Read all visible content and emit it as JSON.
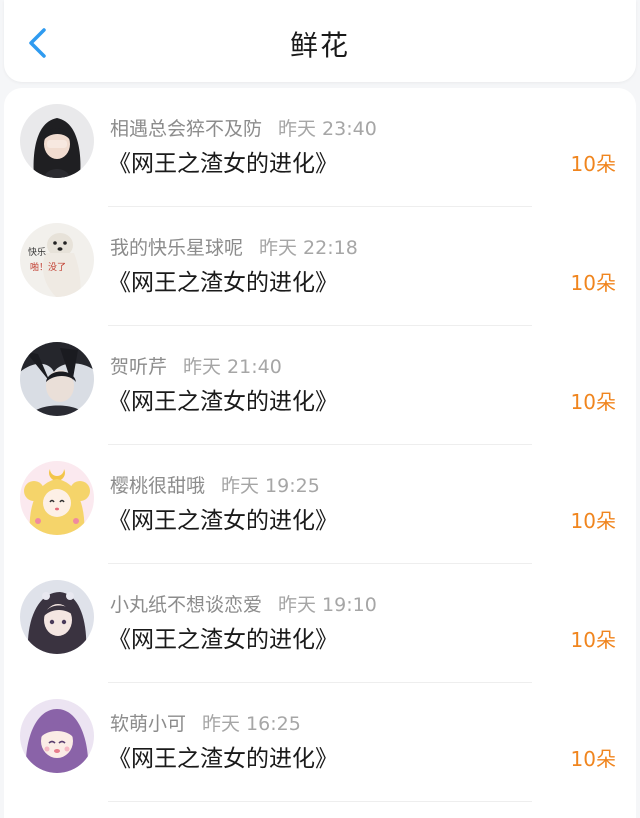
{
  "header": {
    "title": "鲜花"
  },
  "colors": {
    "accent_blue": "#2f9bf0",
    "amount_orange": "#f0851e"
  },
  "rows": [
    {
      "user": "相遇总会猝不及防",
      "time": "昨天 23:40",
      "book": "《网王之渣女的进化》",
      "amount": "10朵",
      "avatar_icon": "avatar-girl-dark-hair-icon"
    },
    {
      "user": "我的快乐星球呢",
      "time": "昨天 22:18",
      "book": "《网王之渣女的进化》",
      "amount": "10朵",
      "avatar_icon": "avatar-dog-meme-icon"
    },
    {
      "user": "贺听芹",
      "time": "昨天 21:40",
      "book": "《网王之渣女的进化》",
      "amount": "10朵",
      "avatar_icon": "avatar-anime-boy-icon"
    },
    {
      "user": "樱桃很甜哦",
      "time": "昨天 19:25",
      "book": "《网王之渣女的进化》",
      "amount": "10朵",
      "avatar_icon": "avatar-sailor-moon-icon"
    },
    {
      "user": "小丸纸不想谈恋爱",
      "time": "昨天 19:10",
      "book": "《网王之渣女的进化》",
      "amount": "10朵",
      "avatar_icon": "avatar-anime-girl-icon"
    },
    {
      "user": "软萌小可",
      "time": "昨天 16:25",
      "book": "《网王之渣女的进化》",
      "amount": "10朵",
      "avatar_icon": "avatar-purple-hair-girl-icon"
    }
  ],
  "avatar_texts": {
    "meme_line1": "快乐",
    "meme_line2": "啪！没了"
  }
}
